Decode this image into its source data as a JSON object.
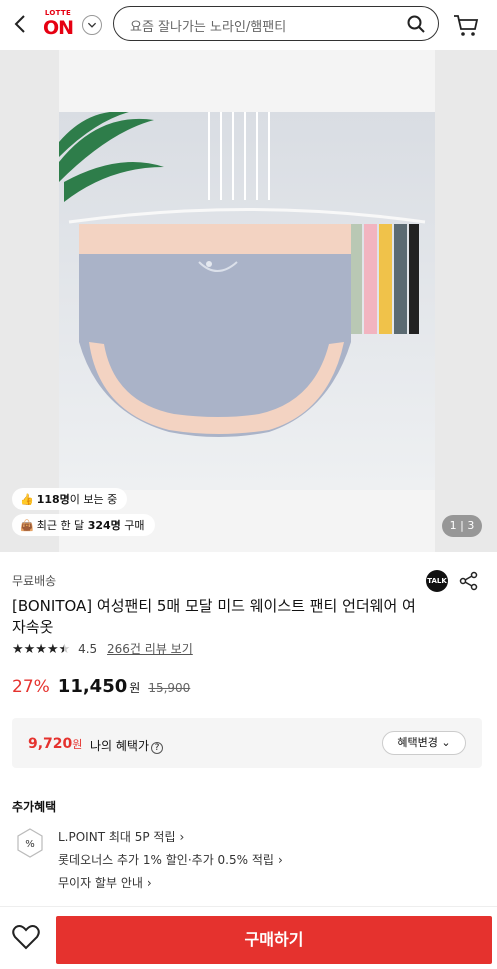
{
  "header": {
    "logo_small": "LOTTE",
    "logo_big": "ON",
    "search_placeholder": "요즘 잘나가는 노라인/햄팬티"
  },
  "hero": {
    "viewers_count": "118명",
    "viewers_suffix": "이 보는 중",
    "recent_prefix": "최근 한 달 ",
    "recent_count": "324명",
    "recent_suffix": " 구매",
    "pager": "1 | 3"
  },
  "product": {
    "free_shipping": "무료배송",
    "talk_label": "TALK",
    "title": "[BONITOA] 여성팬티 5매 모달 미드 웨이스트 팬티 언더웨어 여자속옷",
    "rating": "4.5",
    "star_fill": 4.5,
    "review_link": "266건 리뷰 보기",
    "discount": "27%",
    "price": "11,450",
    "won": "원",
    "original_price": "15,900"
  },
  "benefit": {
    "my_price": "9,720",
    "my_price_unit": "원",
    "my_label": "나의 혜택가",
    "change_label": "혜택변경"
  },
  "extra": {
    "title": "추가혜택",
    "lines": [
      "L.POINT 최대 5P 적립",
      "롯데오너스 추가 1% 할인·추가 0.5% 적립",
      "무이자 할부 안내"
    ]
  },
  "bottom": {
    "buy_label": "구매하기"
  },
  "colors": {
    "brand_red": "#e60012",
    "price_red": "#e5322e"
  },
  "icons": [
    "back-arrow-icon",
    "chevron-down-icon",
    "search-icon",
    "cart-icon",
    "thumbs-up-icon",
    "shopping-bag-icon",
    "share-icon",
    "help-icon",
    "percent-badge-icon",
    "heart-icon"
  ]
}
